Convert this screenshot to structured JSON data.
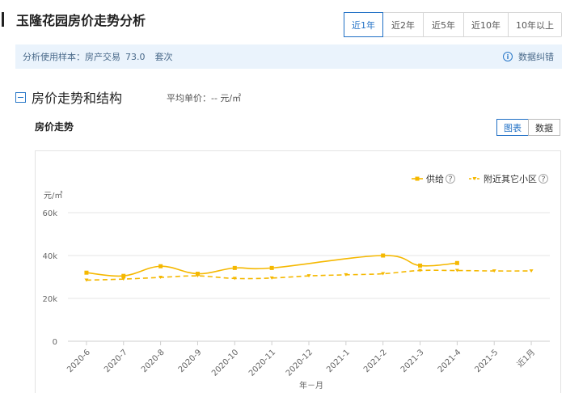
{
  "header": {
    "title": "玉隆花园房价走势分析",
    "range_tabs": [
      "近1年",
      "近2年",
      "近5年",
      "近10年",
      "10年以上"
    ],
    "active_range": "近1年"
  },
  "info": {
    "sample_prefix": "分析使用样本：房产交易",
    "sample_value": "73.0",
    "sample_unit": "套次",
    "correct_label": "数据纠错"
  },
  "section": {
    "title": "房价走势和结构",
    "avg_label": "平均单价：",
    "avg_value": "-- 元/㎡"
  },
  "chart_header": {
    "title": "房价走势",
    "views": [
      "图表",
      "数据"
    ],
    "active_view": "图表"
  },
  "chart_data": {
    "type": "line",
    "categories": [
      "2020-6",
      "2020-7",
      "2020-8",
      "2020-9",
      "2020-10",
      "2020-11",
      "2020-12",
      "2021-1",
      "2021-2",
      "2021-3",
      "2021-4",
      "2021-5",
      "近1月"
    ],
    "series": [
      {
        "name": "供给",
        "style": "solid",
        "color": "#f5b800",
        "values": [
          32000,
          30500,
          35000,
          31500,
          34200,
          34200,
          null,
          null,
          40000,
          35300,
          36500,
          null,
          null
        ]
      },
      {
        "name": "附近其它小区",
        "style": "dashed",
        "color": "#f5b800",
        "values": [
          28500,
          29000,
          29800,
          30500,
          29300,
          29500,
          30500,
          31000,
          31500,
          33000,
          33000,
          32800,
          32800
        ]
      }
    ],
    "ylabel": "元/㎡",
    "xlabel": "年－月",
    "ylim": [
      0,
      60000
    ],
    "yticks": [
      0,
      20000,
      40000,
      60000
    ],
    "ytick_labels": [
      "0",
      "20k",
      "40k",
      "60k"
    ],
    "grid": true,
    "legend": "top-right"
  }
}
